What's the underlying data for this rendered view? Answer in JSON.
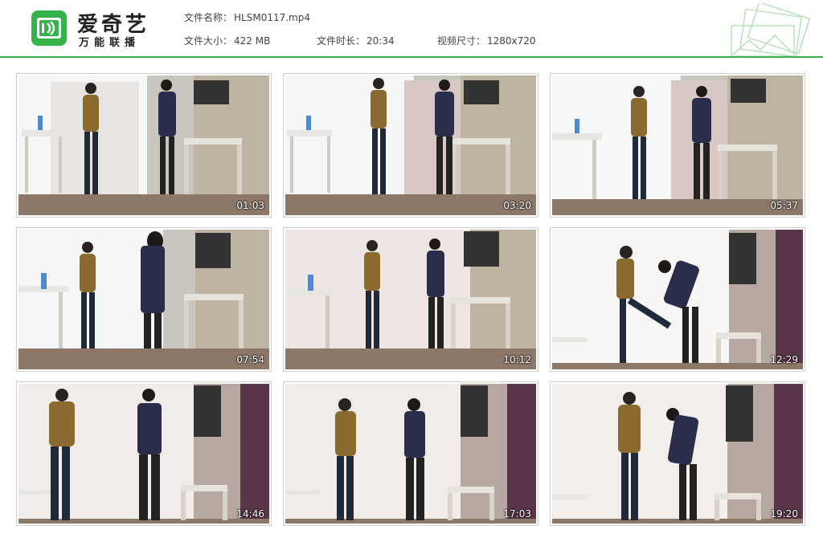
{
  "brand": {
    "title": "爱奇艺",
    "subtitle": "万能联播",
    "accent": "#35b34a"
  },
  "file_info": {
    "name_label": "文件名称：",
    "name_value": "HLSM0117.mp4",
    "size_label": "文件大小：",
    "size_value": "422 MB",
    "duration_label": "文件时长：",
    "duration_value": "20:34",
    "dimensions_label": "视频尺寸：",
    "dimensions_value": "1280x720"
  },
  "thumbnails": [
    {
      "timestamp": "01:03"
    },
    {
      "timestamp": "03:20"
    },
    {
      "timestamp": "05:37"
    },
    {
      "timestamp": "07:54"
    },
    {
      "timestamp": "10:12"
    },
    {
      "timestamp": "12:29"
    },
    {
      "timestamp": "14:46"
    },
    {
      "timestamp": "17:03"
    },
    {
      "timestamp": "19:20"
    }
  ]
}
